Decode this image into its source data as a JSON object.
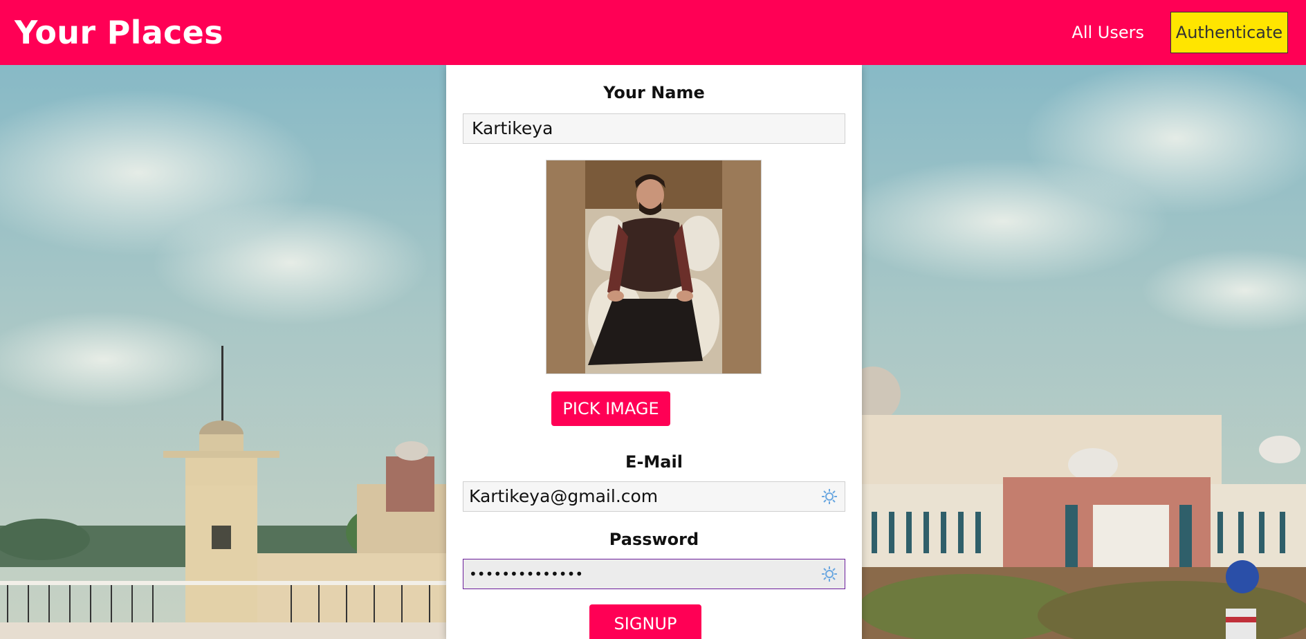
{
  "header": {
    "title": "Your Places",
    "nav": {
      "all_users": "All Users",
      "authenticate": "Authenticate"
    }
  },
  "form": {
    "name_label": "Your Name",
    "name_value": "Kartikeya",
    "pick_image_label": "PICK IMAGE",
    "email_label": "E-Mail",
    "email_value": "Kartikeya@gmail.com",
    "password_label": "Password",
    "password_value": "••••••••••••••",
    "signup_label": "SIGNUP"
  },
  "icons": {
    "field_icon": "password-manager-key-icon"
  },
  "colors": {
    "header_bg": "#ff0055",
    "auth_button_bg": "#ffe500",
    "primary_button_bg": "#ff0055",
    "active_field_border": "#6a1b9a"
  }
}
